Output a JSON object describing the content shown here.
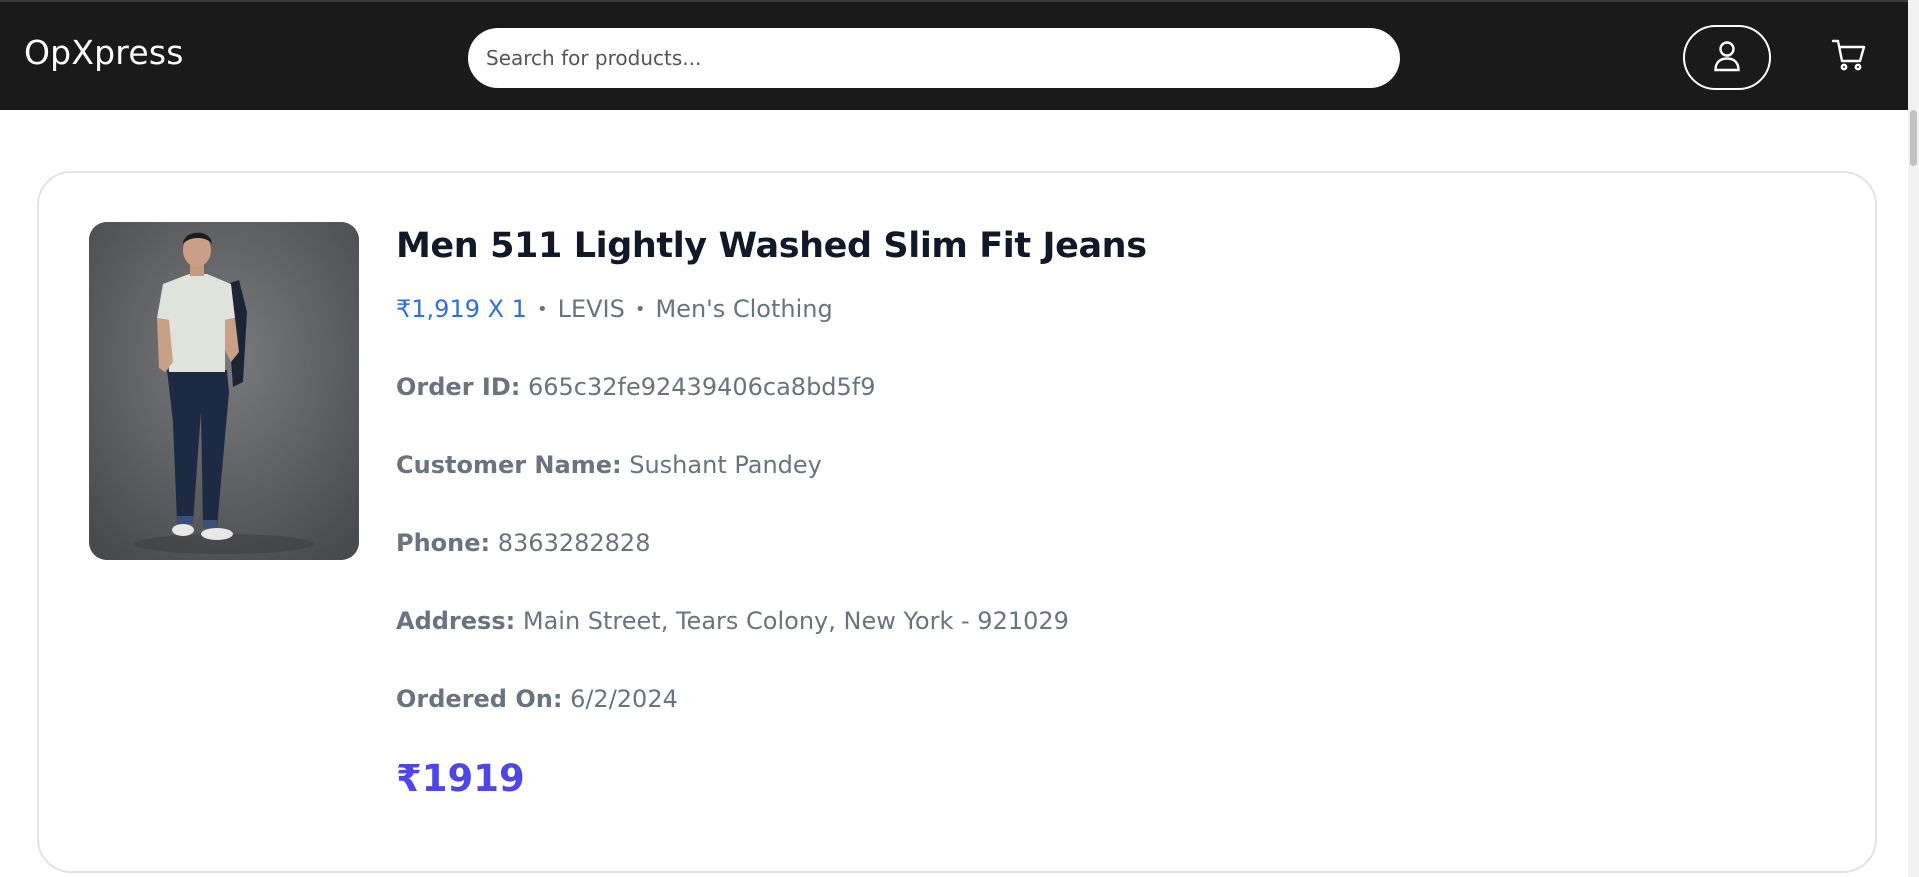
{
  "navbar": {
    "brand": "OpXpress",
    "search_placeholder": "Search for products...",
    "account_icon": "user-icon",
    "cart_icon": "cart-icon",
    "background": "#1a1a1a"
  },
  "order": {
    "product_title": "Men 511 Lightly Washed Slim Fit Jeans",
    "price_qty": "₹1,919 X 1",
    "separator": "•",
    "brand": "LEVIS",
    "category": "Men's Clothing",
    "fields": [
      {
        "label": "Order ID:",
        "value": "665c32fe92439406ca8bd5f9"
      },
      {
        "label": "Customer Name:",
        "value": "Sushant Pandey"
      },
      {
        "label": "Phone:",
        "value": "8363282828"
      },
      {
        "label": "Address:",
        "value": "Main Street, Tears Colony, New York - 921029"
      },
      {
        "label": "Ordered On:",
        "value": "6/2/2024"
      }
    ],
    "total": "₹1919",
    "colors": {
      "price_accent": "#2f6fe4",
      "total_accent": "#4f46e5",
      "muted_text": "#6b7280",
      "title_text": "#111827"
    }
  }
}
